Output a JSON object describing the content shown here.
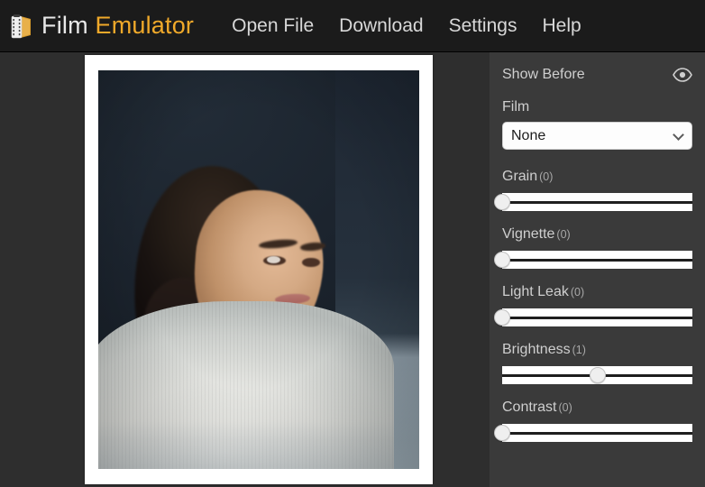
{
  "header": {
    "logo_icon": "film-roll-icon",
    "brand_word1": "Film",
    "brand_word2": "Emulator",
    "brand_accent_color": "#f0a92a",
    "nav": [
      {
        "label": "Open File",
        "name": "nav-open-file"
      },
      {
        "label": "Download",
        "name": "nav-download"
      },
      {
        "label": "Settings",
        "name": "nav-settings"
      },
      {
        "label": "Help",
        "name": "nav-help"
      }
    ]
  },
  "canvas": {
    "photo_alt": "portrait of a woman in a white ribbed sweater against a dark navy background"
  },
  "sidebar": {
    "show_before_label": "Show Before",
    "show_before_icon": "eye-icon",
    "film_label": "Film",
    "film_value": "None",
    "film_options": [
      "None"
    ],
    "sliders": [
      {
        "label": "Grain",
        "value": "0",
        "display": "(0)",
        "percent": 0,
        "name": "grain"
      },
      {
        "label": "Vignette",
        "value": "0",
        "display": "(0)",
        "percent": 0,
        "name": "vignette"
      },
      {
        "label": "Light Leak",
        "value": "0",
        "display": "(0)",
        "percent": 0,
        "name": "light-leak"
      },
      {
        "label": "Brightness",
        "value": "1",
        "display": "(1)",
        "percent": 50,
        "name": "brightness"
      },
      {
        "label": "Contrast",
        "value": "0",
        "display": "(0)",
        "percent": 0,
        "name": "contrast"
      }
    ]
  },
  "colors": {
    "header_bg": "#1b1b1b",
    "canvas_bg": "#2e2e2e",
    "sidebar_bg": "#3a3a3a",
    "text": "#cfcfcf",
    "accent": "#f0a92a"
  }
}
